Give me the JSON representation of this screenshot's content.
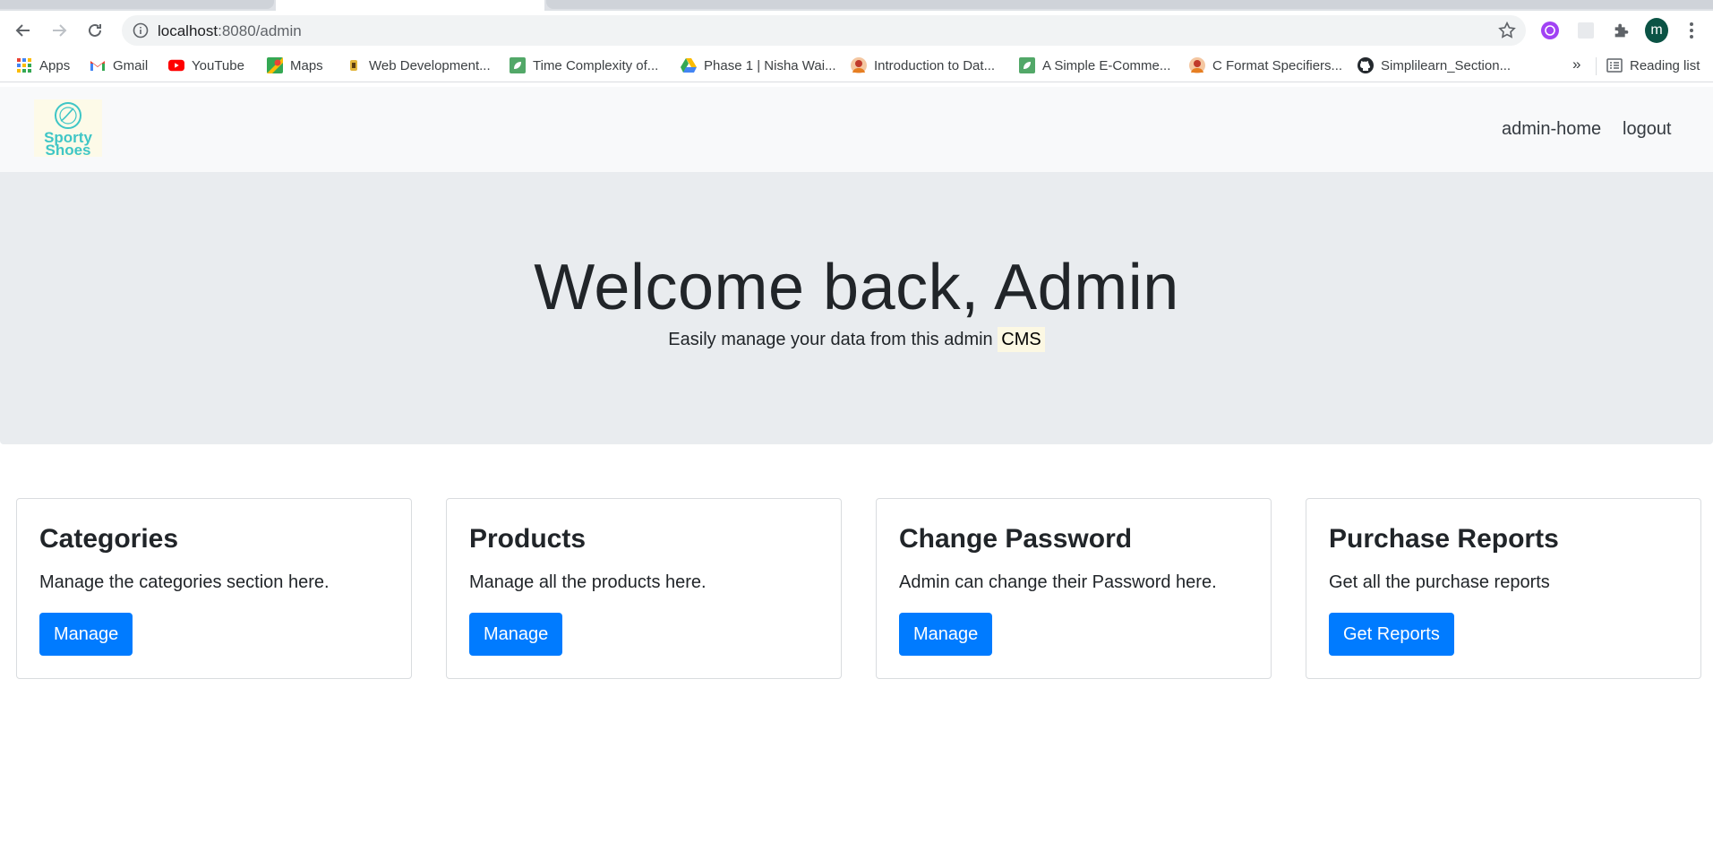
{
  "browser": {
    "url_host": "localhost",
    "url_path": ":8080/admin",
    "profile_initial": "m",
    "bookmarks": [
      {
        "label": "Apps",
        "icon": "apps-grid-icon"
      },
      {
        "label": "Gmail",
        "icon": "gmail-icon"
      },
      {
        "label": "YouTube",
        "icon": "youtube-icon"
      },
      {
        "label": "Maps",
        "icon": "maps-icon"
      },
      {
        "label": "Web Development...",
        "icon": "web-dev-icon"
      },
      {
        "label": "Time Complexity of...",
        "icon": "leaf-icon"
      },
      {
        "label": "Phase 1 | Nisha Wai...",
        "icon": "drive-icon"
      },
      {
        "label": "Introduction to Dat...",
        "icon": "avatar-icon"
      },
      {
        "label": "A Simple E-Comme...",
        "icon": "leaf-icon"
      },
      {
        "label": "C Format Specifiers...",
        "icon": "avatar-icon"
      },
      {
        "label": "Simplilearn_Section...",
        "icon": "github-icon"
      }
    ],
    "more_bookmarks": "»",
    "reading_list": "Reading list"
  },
  "navbar": {
    "logo_line1": "Sporty",
    "logo_line2": "Shoes",
    "links": [
      "admin-home",
      "logout"
    ]
  },
  "hero": {
    "title": "Welcome back, Admin",
    "subtitle": "Easily manage your data from this admin",
    "subtitle_mark": "CMS"
  },
  "cards": [
    {
      "title": "Categories",
      "text": "Manage the categories section here.",
      "button": "Manage"
    },
    {
      "title": "Products",
      "text": "Manage all the products here.",
      "button": "Manage"
    },
    {
      "title": "Change Password",
      "text": "Admin can change their Password here.",
      "button": "Manage"
    },
    {
      "title": "Purchase Reports",
      "text": "Get all the purchase reports",
      "button": "Get Reports"
    }
  ],
  "colors": {
    "primary": "#007bff",
    "hero_bg": "#e9ecef",
    "navbar_bg": "#f8f9fa",
    "mark_bg": "#fcf8e3",
    "logo_teal": "#3fc6c6"
  }
}
